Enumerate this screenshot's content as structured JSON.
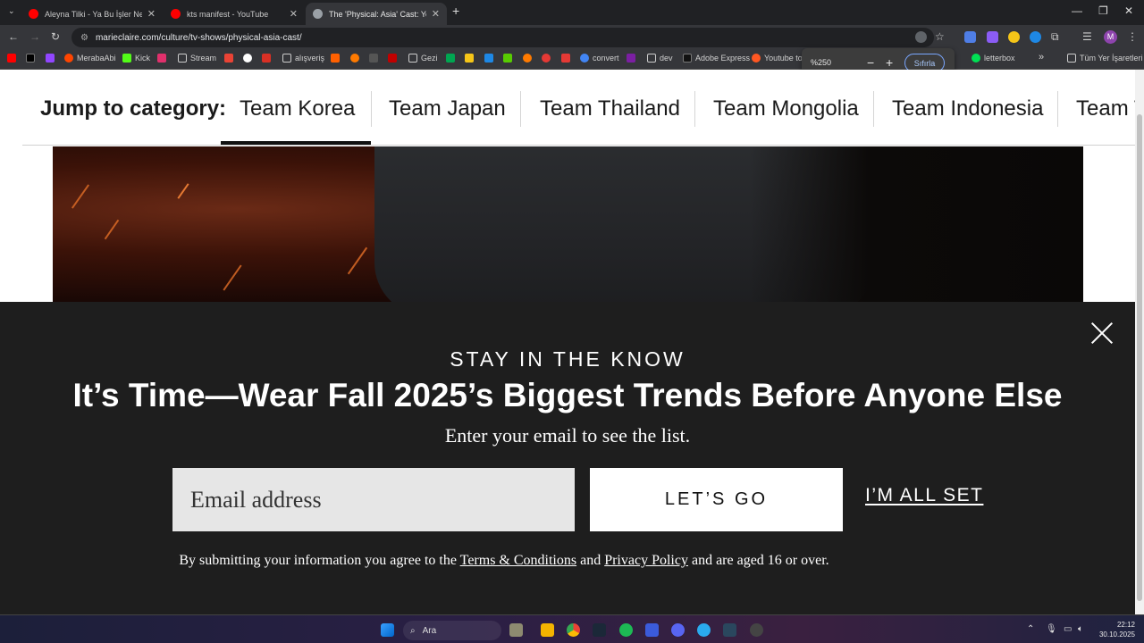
{
  "browser": {
    "tabs": [
      {
        "title": "Aleyna Tilki - Ya Bu İşler Ne ( Vi",
        "favicon_color": "#ff0000",
        "active": false
      },
      {
        "title": "kts manifest - YouTube",
        "favicon_color": "#ff0000",
        "active": false
      },
      {
        "title": "The 'Physical: Asia' Cast: Your G",
        "favicon_color": "#9aa0a6",
        "active": true
      }
    ],
    "new_tab_label": "+",
    "url": "marieclaire.com/culture/tv-shows/physical-asia-cast/",
    "profile_initial": "M",
    "bookmarks": [
      {
        "label": "",
        "icon": "youtube-icon",
        "color": "#ff0000"
      },
      {
        "label": "",
        "icon": "x-icon",
        "color": "#000000"
      },
      {
        "label": "",
        "icon": "twitch-icon",
        "color": "#9146ff"
      },
      {
        "label": "MerabaAbi",
        "icon": "reddit-icon",
        "color": "#ff4500"
      },
      {
        "label": "Kick",
        "icon": "kick-icon",
        "color": "#53fc18"
      },
      {
        "label": "",
        "icon": "instagram-icon",
        "color": "#e1306c"
      },
      {
        "label": "Stream",
        "icon": "folder-icon",
        "color": "#9aa0a6"
      },
      {
        "label": "",
        "icon": "gmail-icon",
        "color": "#ea4335"
      },
      {
        "label": "",
        "icon": "github-icon",
        "color": "#ffffff"
      },
      {
        "label": "",
        "icon": "mail-icon",
        "color": "#d93025"
      },
      {
        "label": "alışveriş",
        "icon": "folder-icon",
        "color": "#9aa0a6"
      },
      {
        "label": "",
        "icon": "hb-icon",
        "color": "#ff6000"
      },
      {
        "label": "",
        "icon": "p-icon",
        "color": "#ff7a00"
      },
      {
        "label": "",
        "icon": "k-icon",
        "color": "#ffffff"
      },
      {
        "label": "",
        "icon": "red-icon",
        "color": "#c00000"
      },
      {
        "label": "Gezi",
        "icon": "folder-icon",
        "color": "#9aa0a6"
      },
      {
        "label": "",
        "icon": "flag-icon",
        "color": "#00a651"
      },
      {
        "label": "",
        "icon": "t-icon",
        "color": "#f5c518"
      },
      {
        "label": "",
        "icon": "blue-icon",
        "color": "#1e88e5"
      },
      {
        "label": "",
        "icon": "green-icon",
        "color": "#58cc02"
      },
      {
        "label": "",
        "icon": "orange-icon",
        "color": "#ff7a00"
      },
      {
        "label": "",
        "icon": "crimson-icon",
        "color": "#e53935"
      },
      {
        "label": "",
        "icon": "red-x-icon",
        "color": "#e53935"
      },
      {
        "label": "convert",
        "icon": "globe-icon",
        "color": "#4285f4"
      },
      {
        "label": "",
        "icon": "purple-icon",
        "color": "#7b1fa2"
      },
      {
        "label": "dev",
        "icon": "folder-icon",
        "color": "#9aa0a6"
      },
      {
        "label": "Adobe Express",
        "icon": "adobe-icon",
        "color": "#000000"
      },
      {
        "label": "Youtube to",
        "icon": "ytconv-icon",
        "color": "#ff5722"
      },
      {
        "label": "letterbox",
        "icon": "letterboxd-icon",
        "color": "#00e054"
      },
      {
        "label": "Tüm Yer İşaretleri",
        "icon": "folder-icon",
        "color": "#9aa0a6"
      }
    ],
    "more_bookmarks_label": "»",
    "zoom": {
      "level": "%250",
      "minus": "−",
      "plus": "+",
      "reset_label": "Sıfırla"
    }
  },
  "page": {
    "jump_label": "Jump to category:",
    "categories": [
      "Team Korea",
      "Team Japan",
      "Team Thailand",
      "Team Mongolia",
      "Team Indonesia",
      "Team T"
    ],
    "active_category": "Team Korea",
    "newsletter": {
      "kicker": "STAY IN THE KNOW",
      "headline": "It’s Time—Wear Fall 2025’s Biggest Trends Before Anyone Else",
      "subtitle": "Enter your email to see the list.",
      "email_placeholder": "Email address",
      "submit_label": "LET’S GO",
      "dismiss_label": "I’M ALL SET",
      "legal_prefix": "By submitting your information you agree to the",
      "terms_label": "Terms & Conditions",
      "legal_and": "and",
      "privacy_label": "Privacy Policy",
      "legal_suffix": "and are aged 16 or over."
    }
  },
  "taskbar": {
    "search_label": "Ara",
    "time": "22:12",
    "date": "30.10.2025"
  }
}
